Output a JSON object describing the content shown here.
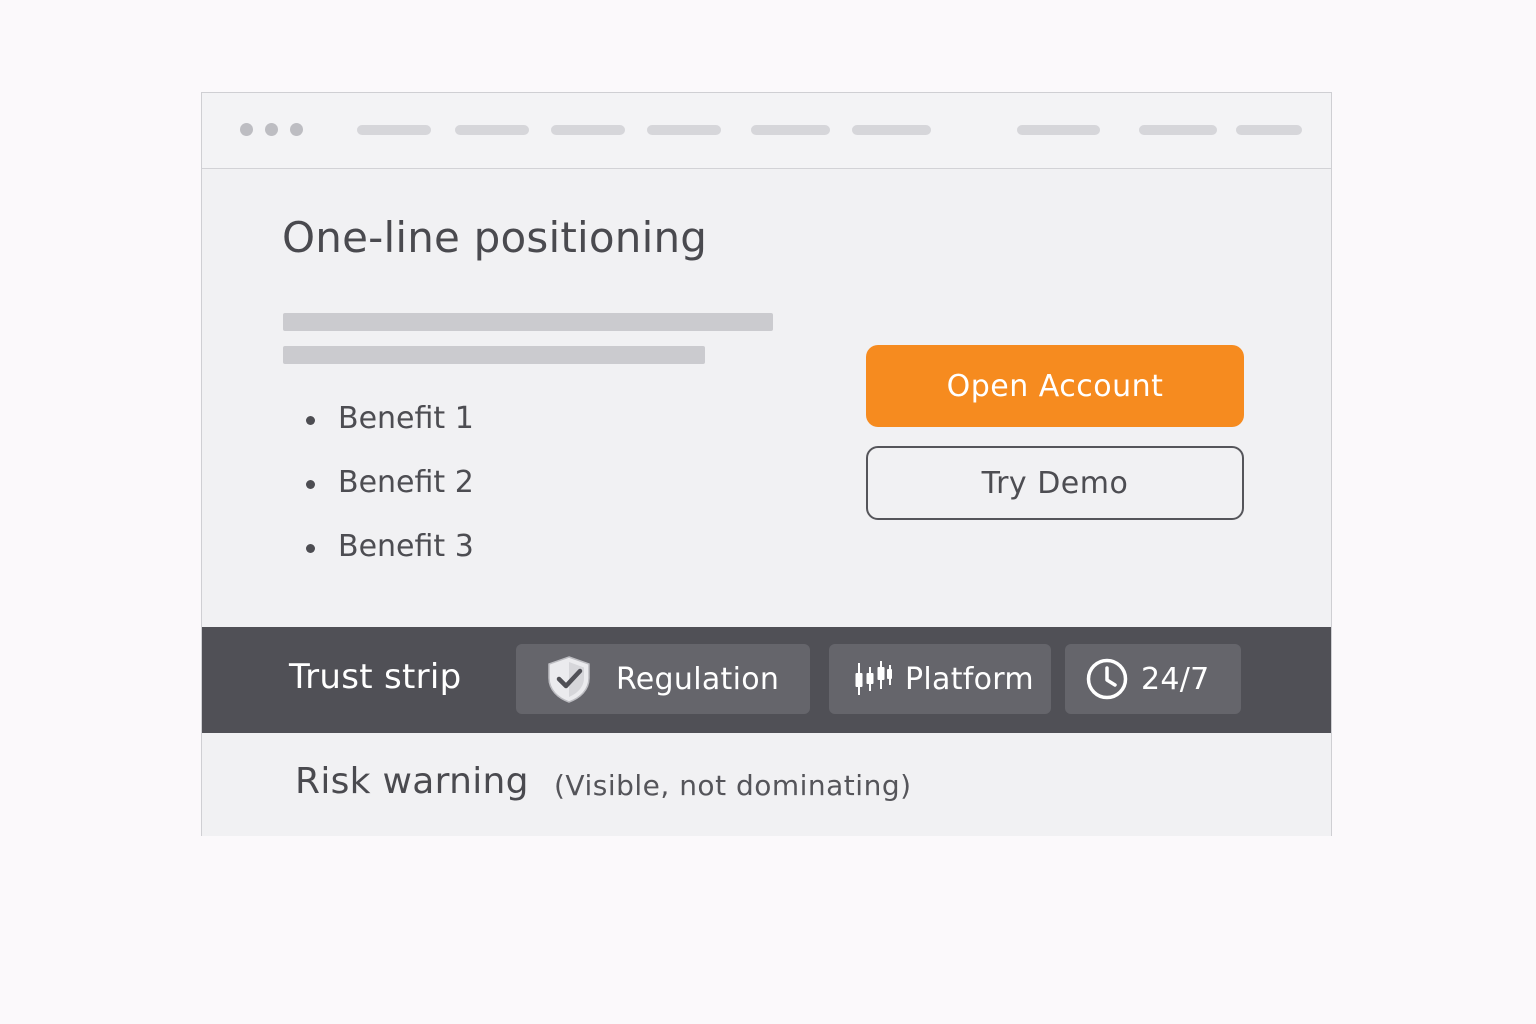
{
  "hero": {
    "headline": "One-line positioning",
    "benefits": [
      "Benefit 1",
      "Benefit 2",
      "Benefit 3"
    ],
    "primary_cta": "Open Account",
    "secondary_cta": "Try Demo"
  },
  "trust_strip": {
    "label": "Trust strip",
    "items": [
      {
        "label": "Regulation",
        "icon": "shield-check-icon"
      },
      {
        "label": "Platform",
        "icon": "candlestick-icon"
      },
      {
        "label": "24/7",
        "icon": "clock-icon"
      }
    ]
  },
  "risk": {
    "title": "Risk warning",
    "note": "(Visible, not dominating)"
  },
  "colors": {
    "accent": "#f68b1f",
    "trust_strip_bg": "#505056",
    "window_bg": "#f1f1f3"
  }
}
